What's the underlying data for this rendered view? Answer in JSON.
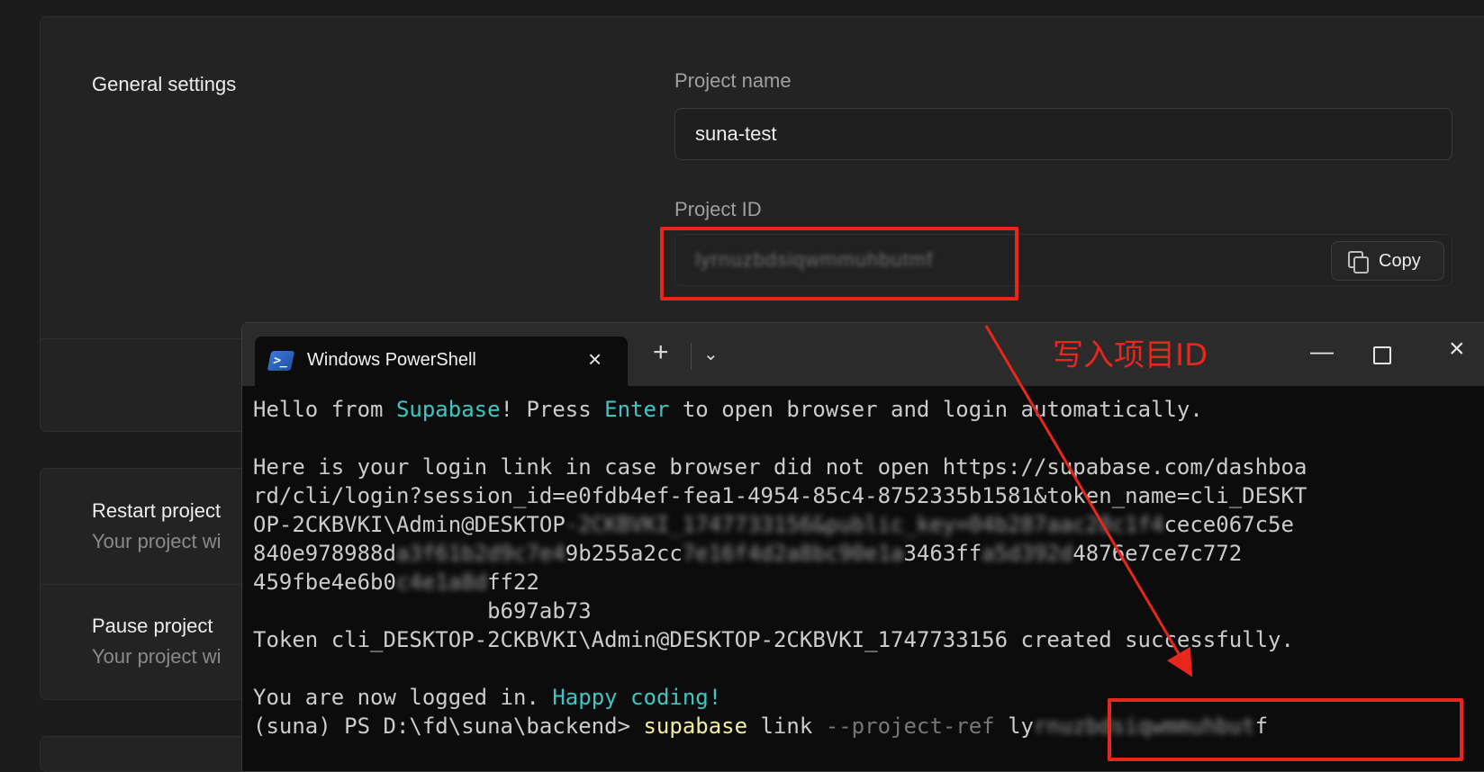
{
  "settings": {
    "section_title": "General settings",
    "project_name_label": "Project name",
    "project_name_value": "suna-test",
    "project_id_label": "Project ID",
    "project_id_value": "lyrnuzbdsiqwmmuhbutmf",
    "copy_label": "Copy",
    "restart_title": "Restart project",
    "restart_desc": "Your project wi",
    "pause_title": "Pause project",
    "pause_desc": "Your project wi"
  },
  "terminal_window": {
    "tab_title": "Windows PowerShell",
    "tab_close": "×",
    "new_tab": "+",
    "dropdown": "⌄",
    "minimize": "—",
    "close": "×",
    "annotation": "写入项目ID"
  },
  "terminal": {
    "l1_a": "Hello from ",
    "l1_b": "Supabase",
    "l1_c": "! Press ",
    "l1_d": "Enter",
    "l1_e": " to open browser and login automatically.",
    "l2": "Here is your login link in case browser did not open https://supabase.com/dashboa",
    "l3": "rd/cli/login?session_id=e0fdb4ef-fea1-4954-85c4-8752335b1581&token_name=cli_DESKT",
    "l4_a": "OP-2CKBVKI\\Admin@DESKTOP",
    "l4_b": "-2CKBVKI_1747733156&public_key=04b287aac28c1f4",
    "l4_c": "cece067c5e",
    "l5_a": "840e978988d",
    "l5_b": "a3f61b2d9c7e4",
    "l5_c": "9b255a2cc",
    "l5_d": "7e16f4d2a8bc90e1a",
    "l5_e": "3463ff",
    "l5_f": "a5d392d",
    "l5_g": "4876e7ce7c772",
    "l6_a": "459fbe4e6b0",
    "l6_b": "c4e1a8d",
    "l6_c": "ff22",
    "l7": "                  b697ab73",
    "l8": "Token cli_DESKTOP-2CKBVKI\\Admin@DESKTOP-2CKBVKI_1747733156 created successfully.",
    "l9_a": "You are now logged in. ",
    "l9_b": "Happy coding!",
    "l10_a": "(suna) PS D:\\fd\\suna\\backend> ",
    "l10_b": "supabase",
    "l10_c": " link ",
    "l10_d": "--project-ref",
    "l10_e": " ly",
    "l10_f": "rnuzbdsiqwmmuhbut",
    "l10_g": "f"
  },
  "colors": {
    "accent": "#3cc7c4",
    "command": "#f1eea4",
    "highlight": "#e8261c"
  }
}
